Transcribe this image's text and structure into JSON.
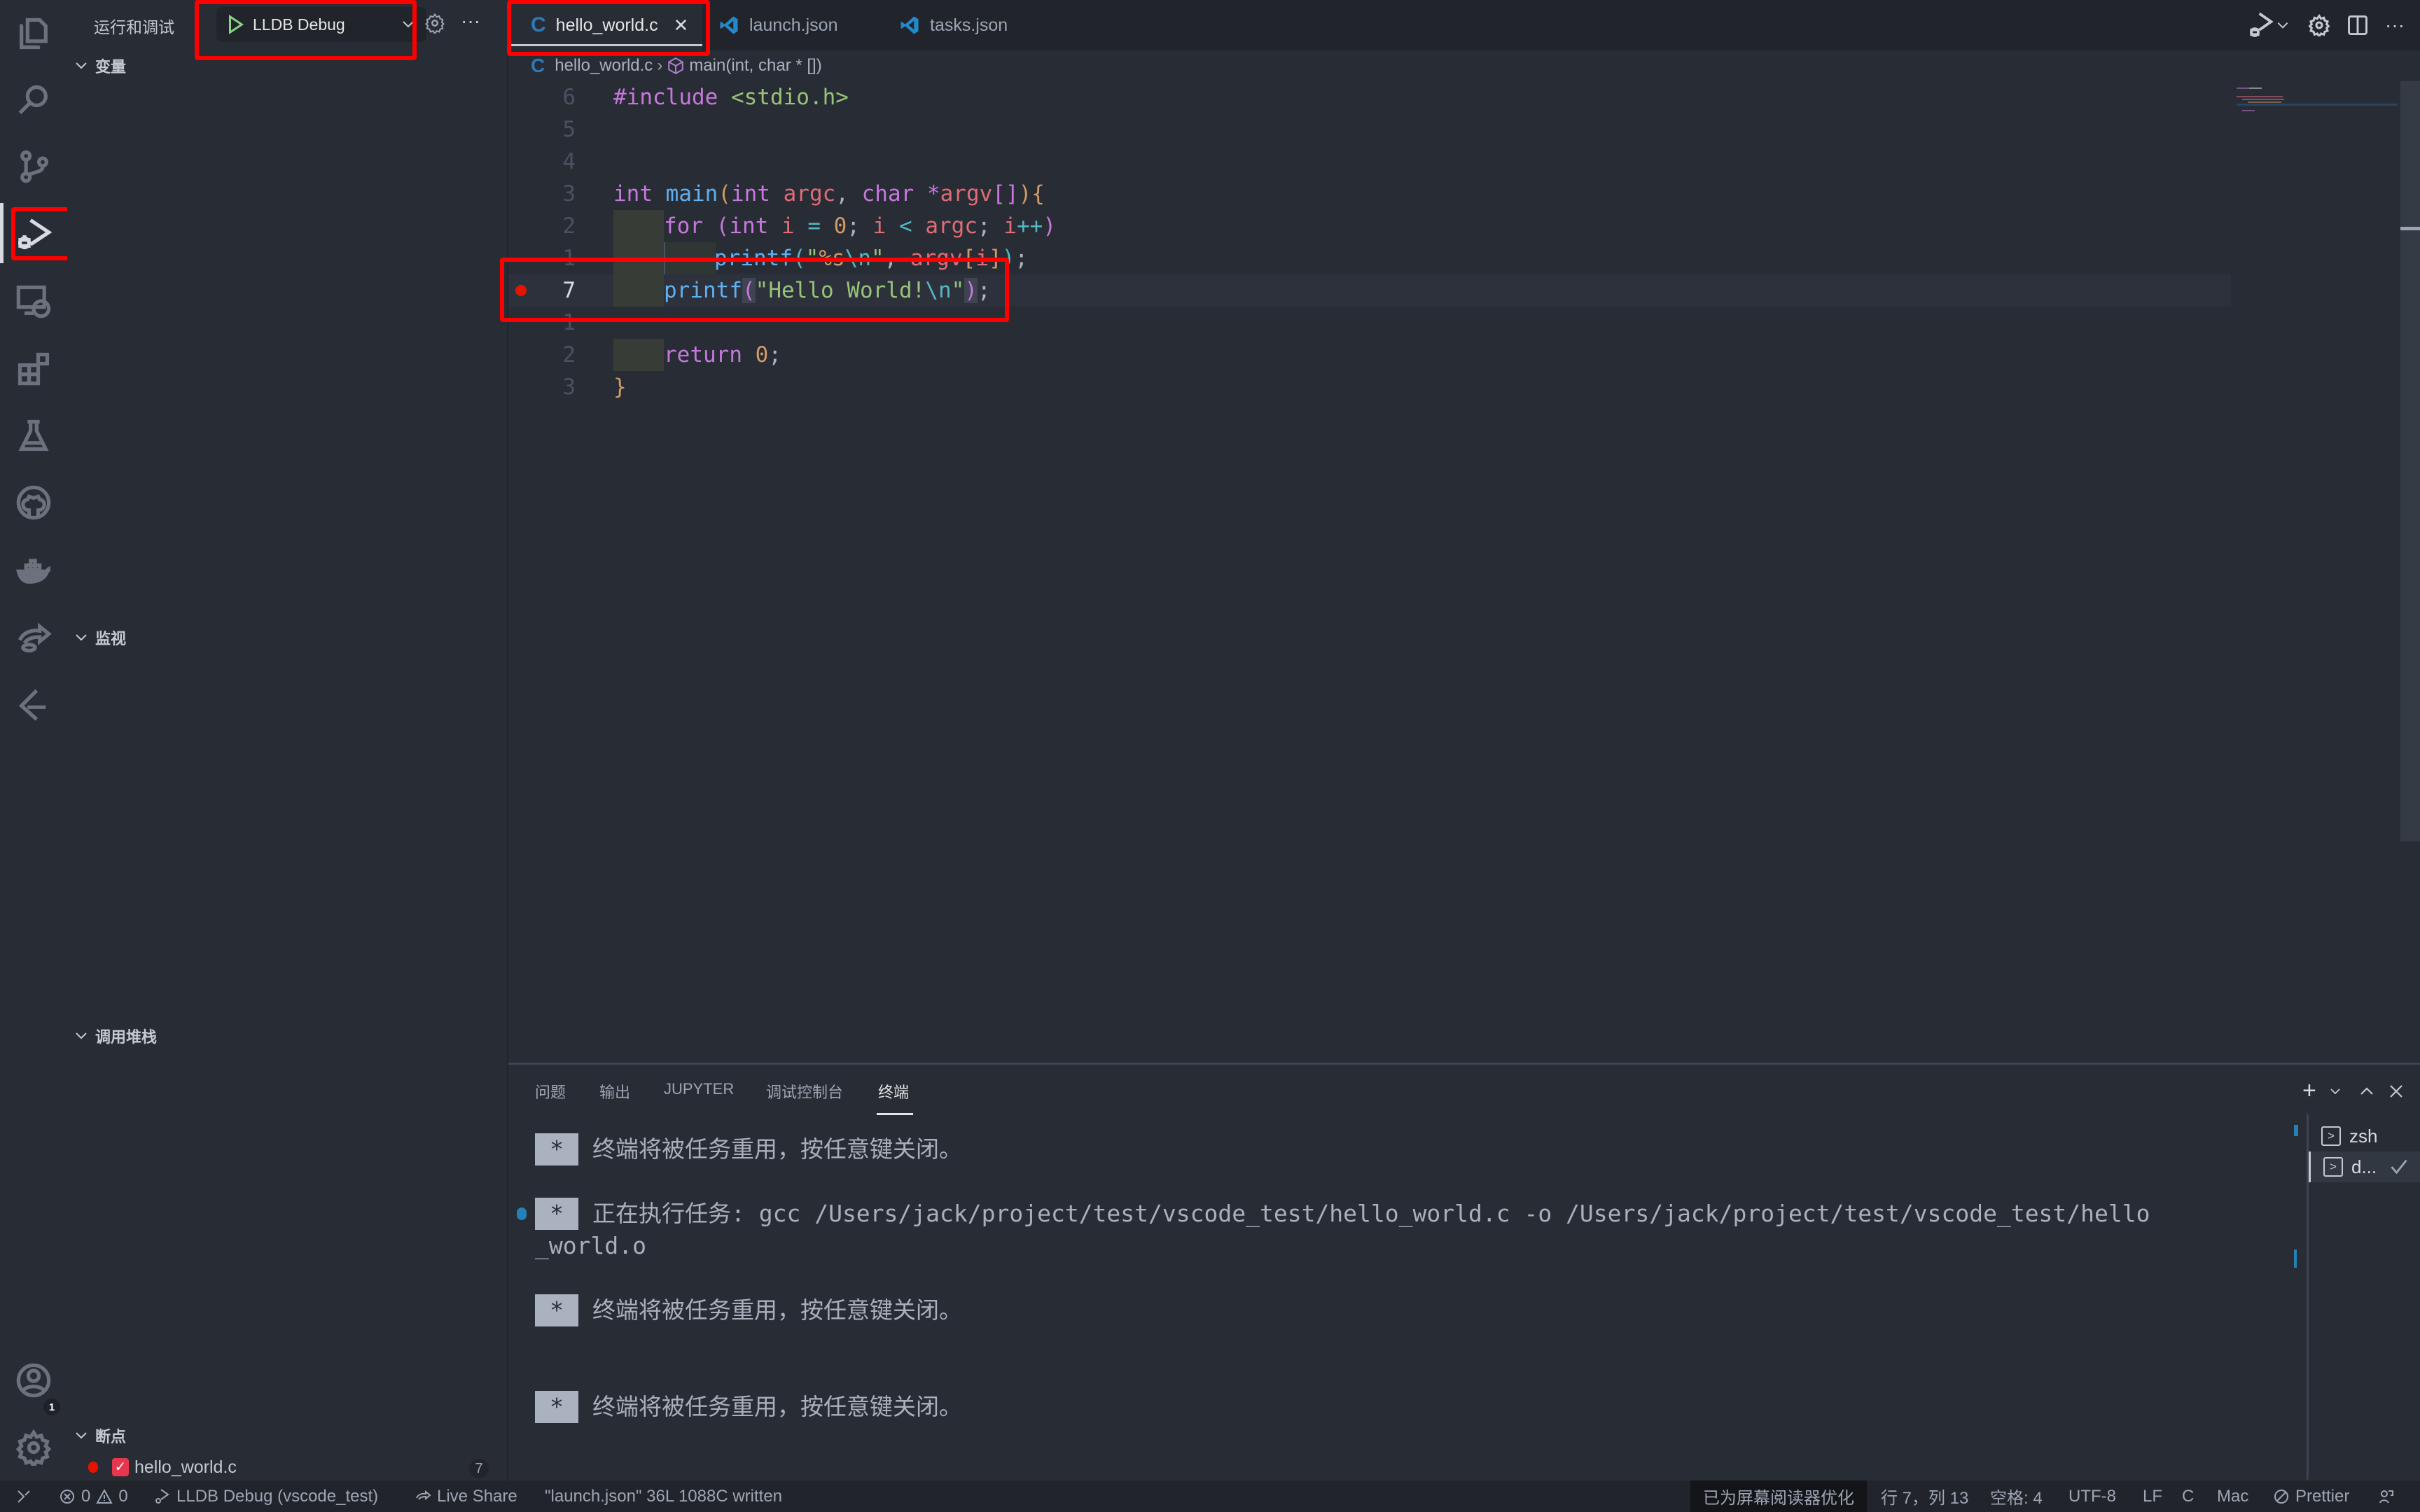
{
  "activity_bar": {
    "items": [
      {
        "name": "explorer",
        "icon": "files-icon"
      },
      {
        "name": "search",
        "icon": "search-icon"
      },
      {
        "name": "source-control",
        "icon": "source-control-icon"
      },
      {
        "name": "run-debug",
        "icon": "run-debug-icon",
        "active": true
      },
      {
        "name": "remote-explorer",
        "icon": "remote-explorer-icon"
      },
      {
        "name": "extensions",
        "icon": "extensions-icon"
      },
      {
        "name": "testing",
        "icon": "beaker-icon"
      },
      {
        "name": "github",
        "icon": "github-icon"
      },
      {
        "name": "docker",
        "icon": "docker-icon"
      },
      {
        "name": "live-share",
        "icon": "live-share-icon"
      },
      {
        "name": "gitlens",
        "icon": "gitlens-icon"
      }
    ],
    "accounts_badge": "1"
  },
  "sidebar": {
    "title": "运行和调试",
    "config_select": "LLDB Debug",
    "sections": {
      "variables": "变量",
      "watch": "监视",
      "call_stack": "调用堆栈",
      "breakpoints": "断点"
    },
    "breakpoints": [
      {
        "file": "hello_world.c",
        "line": "7",
        "enabled": true
      }
    ]
  },
  "tabs": [
    {
      "label": "hello_world.c",
      "icon": "C",
      "active": true
    },
    {
      "label": "launch.json",
      "icon": "vscode-icon",
      "active": false
    },
    {
      "label": "tasks.json",
      "icon": "vscode-icon",
      "active": false
    }
  ],
  "breadcrumb": {
    "file": "hello_world.c",
    "symbol": "main(int, char * [])"
  },
  "editor": {
    "lines": [
      {
        "num": "6",
        "tokens": [
          [
            "k-purple",
            "#include "
          ],
          [
            "k-green",
            "<stdio.h>"
          ]
        ]
      },
      {
        "num": "5",
        "tokens": []
      },
      {
        "num": "4",
        "tokens": []
      },
      {
        "num": "3",
        "tokens": [
          [
            "k-purple",
            "int "
          ],
          [
            "k-blue",
            "main"
          ],
          [
            "k-orange",
            "("
          ],
          [
            "k-purple",
            "int "
          ],
          [
            "k-red",
            "argc"
          ],
          [
            "k-plain",
            ", "
          ],
          [
            "k-purple",
            "char "
          ],
          [
            "k-purple",
            "*"
          ],
          [
            "k-red",
            "argv"
          ],
          [
            "k-purple",
            "[]"
          ],
          [
            "k-orange",
            ")"
          ],
          [
            "k-orange",
            "{"
          ]
        ]
      },
      {
        "num": "2",
        "indent": 1,
        "tokens": [
          [
            "k-purple",
            "for "
          ],
          [
            "k-purple",
            "("
          ],
          [
            "k-purple",
            "int "
          ],
          [
            "k-red",
            "i"
          ],
          [
            "k-cyan",
            " = "
          ],
          [
            "k-orange",
            "0"
          ],
          [
            "k-plain",
            "; "
          ],
          [
            "k-red",
            "i"
          ],
          [
            "k-cyan",
            " < "
          ],
          [
            "k-red",
            "argc"
          ],
          [
            "k-plain",
            "; "
          ],
          [
            "k-red",
            "i"
          ],
          [
            "k-cyan",
            "++"
          ],
          [
            "k-purple",
            ")"
          ]
        ]
      },
      {
        "num": "1",
        "indent": 2,
        "tokens": [
          [
            "k-blue",
            "printf"
          ],
          [
            "k-cyan",
            "("
          ],
          [
            "k-green",
            "\""
          ],
          [
            "k-orange",
            "%s"
          ],
          [
            "k-cyan",
            "\\n"
          ],
          [
            "k-green",
            "\""
          ],
          [
            "k-plain",
            ", "
          ],
          [
            "k-red",
            "argv"
          ],
          [
            "k-orange",
            "["
          ],
          [
            "k-red",
            "i"
          ],
          [
            "k-orange",
            "]"
          ],
          [
            "k-cyan",
            ")"
          ],
          [
            "k-plain",
            ";"
          ]
        ]
      },
      {
        "num": "7",
        "indent": 1,
        "current": true,
        "breakpoint": true,
        "tokens": [
          [
            "k-blue",
            "printf"
          ],
          [
            "k-purple brack",
            "("
          ],
          [
            "k-green",
            "\"Hello World!"
          ],
          [
            "k-cyan",
            "\\n"
          ],
          [
            "k-green",
            "\""
          ],
          [
            "k-purple brack",
            ")"
          ],
          [
            "k-plain",
            ";"
          ]
        ]
      },
      {
        "num": "1",
        "tokens": []
      },
      {
        "num": "2",
        "indent": 1,
        "tokens": [
          [
            "k-purple",
            "return "
          ],
          [
            "k-orange",
            "0"
          ],
          [
            "k-plain",
            ";"
          ]
        ]
      },
      {
        "num": "3",
        "tokens": [
          [
            "k-orange",
            "}"
          ]
        ]
      }
    ]
  },
  "panel": {
    "tabs": [
      "问题",
      "输出",
      "JUPYTER",
      "调试控制台",
      "终端"
    ],
    "active_tab": "终端",
    "terminal": {
      "lines": [
        {
          "star": "*",
          "text": "终端将被任务重用，按任意键关闭。"
        },
        {
          "star": "*",
          "text": "正在执行任务: gcc /Users/jack/project/test/vscode_test/hello_world.c -o /Users/jack/project/test/vscode_test/hello",
          "dot": true
        },
        {
          "text": "_world.o"
        },
        {
          "star": "*",
          "text": "终端将被任务重用，按任意键关闭。"
        },
        {
          "star": "*",
          "text": "终端将被任务重用，按任意键关闭。"
        }
      ],
      "instances": [
        {
          "label": "zsh",
          "selected": false
        },
        {
          "label": "d...",
          "selected": true,
          "check": true
        }
      ]
    }
  },
  "statusbar": {
    "errors": "0",
    "warnings": "0",
    "debug": "LLDB Debug (vscode_test)",
    "live_share": "Live Share",
    "message": "\"launch.json\" 36L 1088C written",
    "screen_reader": "已为屏幕阅读器优化",
    "position": "行 7，列 13",
    "spaces": "空格: 4",
    "encoding": "UTF-8",
    "eol": "LF",
    "language": "C",
    "platform": "Mac",
    "prettier": "Prettier"
  },
  "colors": {
    "accent_breakpoint": "#e51400",
    "highlight_box": "#ff0000",
    "bg": "#282c34"
  }
}
